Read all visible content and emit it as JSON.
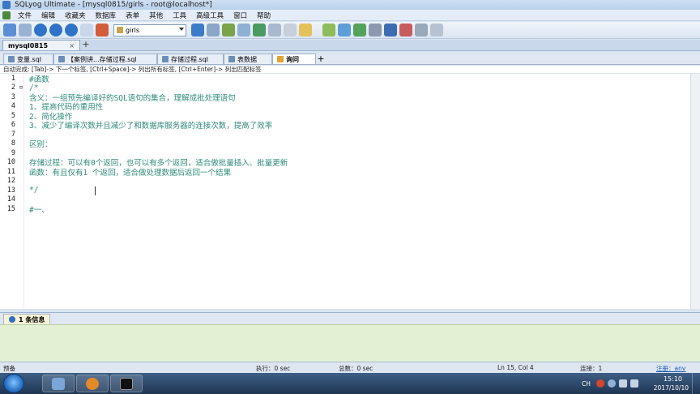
{
  "window": {
    "title": "SQLyog Ultimate - [mysql0815/girls - root@localhost*]"
  },
  "menu": {
    "items": [
      "文件",
      "编辑",
      "收藏夹",
      "数据库",
      "表单",
      "其他",
      "工具",
      "高级工具",
      "窗口",
      "帮助"
    ]
  },
  "toolbar": {
    "database_select": "girls"
  },
  "connection_tab": {
    "label": "mysql0815",
    "close": "×",
    "add": "+"
  },
  "query_tabs": {
    "items": [
      {
        "label": "变量.sql",
        "active": false
      },
      {
        "label": "【案例讲...存储过程.sql",
        "active": false
      },
      {
        "label": "存储过程.sql",
        "active": false
      },
      {
        "label": "表数据",
        "active": false
      },
      {
        "label": "询问",
        "active": true
      }
    ],
    "add": "+"
  },
  "hint": "自动完成: [Tab]-> 下一个标签, [Ctrl+Space]-> 列出所有标签, [Ctrl+Enter]-> 列出匹配标签",
  "editor": {
    "lines": [
      {
        "n": "1",
        "fold": "",
        "text": "#函数"
      },
      {
        "n": "2",
        "fold": "⊟",
        "text": "/*"
      },
      {
        "n": "3",
        "fold": "",
        "text": "含义：一组预先编译好的SQL语句的集合，理解成批处理语句"
      },
      {
        "n": "4",
        "fold": "",
        "text": "1、提高代码的重用性"
      },
      {
        "n": "5",
        "fold": "",
        "text": "2、简化操作"
      },
      {
        "n": "6",
        "fold": "",
        "text": "3、减少了编译次数并且减少了和数据库服务器的连接次数，提高了效率"
      },
      {
        "n": "7",
        "fold": "",
        "text": ""
      },
      {
        "n": "8",
        "fold": "",
        "text": "区别："
      },
      {
        "n": "9",
        "fold": "",
        "text": ""
      },
      {
        "n": "10",
        "fold": "",
        "text": "存储过程：可以有0个返回，也可以有多个返回，适合做批量插入、批量更新"
      },
      {
        "n": "11",
        "fold": "",
        "text": "函数：有且仅有1 个返回，适合做处理数据后返回一个结果"
      },
      {
        "n": "12",
        "fold": "",
        "text": ""
      },
      {
        "n": "13",
        "fold": "",
        "text": "*/"
      },
      {
        "n": "14",
        "fold": "",
        "text": ""
      },
      {
        "n": "15",
        "fold": "",
        "text": "#一、"
      }
    ]
  },
  "results": {
    "tab_label": "1 条信息"
  },
  "statusbar": {
    "left": "预备",
    "exec": "执行：0 sec",
    "total": "总数：0 sec",
    "position": "Ln 15, Col 4",
    "connections": "连接：1",
    "register": "注册：anv"
  },
  "taskbar": {
    "lang": "CH",
    "time": "15:10",
    "date": "2017/10/10"
  },
  "colors": {
    "comment_text": "#2e8b7a",
    "results_bg": "#e2f0d4"
  }
}
